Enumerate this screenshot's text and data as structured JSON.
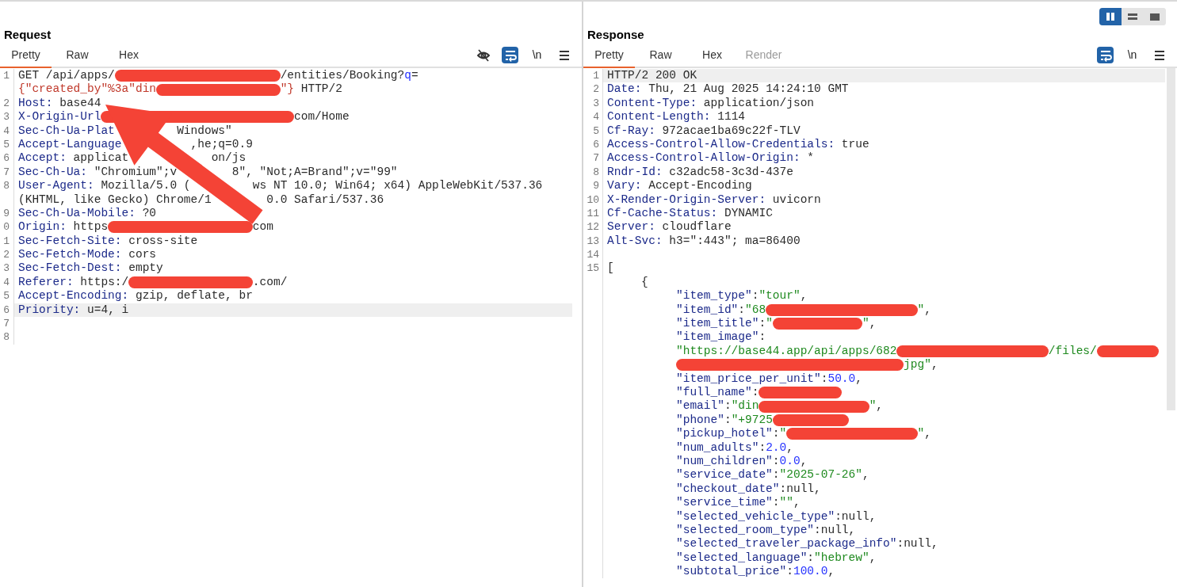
{
  "view_toggle": [
    {
      "kind": "columns",
      "selected": true
    },
    {
      "kind": "rows",
      "selected": false
    },
    {
      "kind": "single",
      "selected": false
    }
  ],
  "request": {
    "title": "Request",
    "tabs": [
      {
        "label": "Pretty",
        "selected": true,
        "disabled": false
      },
      {
        "label": "Raw",
        "selected": false,
        "disabled": false
      },
      {
        "label": "Hex",
        "selected": false,
        "disabled": false
      }
    ],
    "toolbar": [
      {
        "kind": "hide",
        "selected": false
      },
      {
        "kind": "wrap",
        "selected": true
      },
      {
        "kind": "newline",
        "label": "\\n",
        "selected": false
      },
      {
        "kind": "menu",
        "selected": false
      }
    ],
    "rows": [
      {
        "num": "1",
        "kind": "line",
        "selected": false,
        "tokens": [
          {
            "kind": "text",
            "text": "GET /api/apps/"
          },
          {
            "kind": "redacted"
          },
          {
            "kind": "text",
            "text": "/entities/Booking?"
          },
          {
            "kind": "param",
            "text": "q"
          },
          {
            "kind": "text",
            "text": "="
          }
        ]
      },
      {
        "kind": "line",
        "selected": false,
        "tokens": [
          {
            "kind": "query",
            "text": "{\"created_by\"%3a\"din"
          },
          {
            "kind": "redacted"
          },
          {
            "kind": "query",
            "text": "\"}"
          },
          {
            "kind": "text",
            "text": " HTTP/2"
          }
        ]
      },
      {
        "num": "2",
        "kind": "line",
        "selected": false,
        "tokens": [
          {
            "kind": "key",
            "text": "Host:"
          },
          {
            "kind": "text",
            "text": " base44"
          }
        ]
      },
      {
        "num": "3",
        "kind": "line",
        "selected": false,
        "tokens": [
          {
            "kind": "key",
            "text": "X-Origin-Url"
          },
          {
            "kind": "redacted"
          },
          {
            "kind": "text",
            "text": "com/Home"
          }
        ]
      },
      {
        "num": "4",
        "kind": "line",
        "selected": false,
        "tokens": [
          {
            "kind": "key",
            "text": "Sec-Ch-Ua-Plat"
          },
          {
            "kind": "covered"
          },
          {
            "kind": "text",
            "text": "Windows\""
          }
        ]
      },
      {
        "num": "5",
        "kind": "line",
        "selected": false,
        "tokens": [
          {
            "kind": "key",
            "text": "Accept-Language"
          },
          {
            "kind": "covered"
          },
          {
            "kind": "text",
            "text": ",he;q=0.9"
          }
        ]
      },
      {
        "num": "6",
        "kind": "line",
        "selected": false,
        "tokens": [
          {
            "kind": "key",
            "text": "Accept:"
          },
          {
            "kind": "text",
            "text": " applicat"
          },
          {
            "kind": "covered"
          },
          {
            "kind": "text",
            "text": "on/js"
          }
        ]
      },
      {
        "num": "7",
        "kind": "line",
        "selected": false,
        "tokens": [
          {
            "kind": "key",
            "text": "Sec-Ch-Ua:"
          },
          {
            "kind": "text",
            "text": " \"Chromium\";v"
          },
          {
            "kind": "covered"
          },
          {
            "kind": "text",
            "text": "8\", \"Not;A=Brand\";v=\"99\""
          }
        ]
      },
      {
        "num": "8",
        "kind": "line",
        "selected": false,
        "tokens": [
          {
            "kind": "key",
            "text": "User-Agent:"
          },
          {
            "kind": "text",
            "text": " Mozilla/5.0 ("
          },
          {
            "kind": "covered"
          },
          {
            "kind": "text",
            "text": "ws NT 10.0; Win64; x64) AppleWebKit/537.36"
          }
        ]
      },
      {
        "kind": "line",
        "selected": false,
        "tokens": [
          {
            "kind": "text",
            "text": "(KHTML, like Gecko) Chrome/1"
          },
          {
            "kind": "covered"
          },
          {
            "kind": "text",
            "text": "0.0 Safari/537.36"
          }
        ]
      },
      {
        "num": "9",
        "kind": "line",
        "selected": false,
        "tokens": [
          {
            "kind": "key",
            "text": "Sec-Ch-Ua-Mobile:"
          },
          {
            "kind": "text",
            "text": " ?0"
          }
        ]
      },
      {
        "num": "0",
        "kind": "line",
        "selected": false,
        "tokens": [
          {
            "kind": "key",
            "text": "Origin:"
          },
          {
            "kind": "text",
            "text": " https"
          },
          {
            "kind": "redacted"
          },
          {
            "kind": "text",
            "text": "com"
          }
        ]
      },
      {
        "num": "1",
        "kind": "line",
        "selected": false,
        "tokens": [
          {
            "kind": "key",
            "text": "Sec-Fetch-Site:"
          },
          {
            "kind": "text",
            "text": " cross-site"
          }
        ]
      },
      {
        "num": "2",
        "kind": "line",
        "selected": false,
        "tokens": [
          {
            "kind": "key",
            "text": "Sec-Fetch-Mode:"
          },
          {
            "kind": "text",
            "text": " cors"
          }
        ]
      },
      {
        "num": "3",
        "kind": "line",
        "selected": false,
        "tokens": [
          {
            "kind": "key",
            "text": "Sec-Fetch-Dest:"
          },
          {
            "kind": "text",
            "text": " empty"
          }
        ]
      },
      {
        "num": "4",
        "kind": "line",
        "selected": false,
        "tokens": [
          {
            "kind": "key",
            "text": "Referer:"
          },
          {
            "kind": "text",
            "text": " https:/"
          },
          {
            "kind": "redacted"
          },
          {
            "kind": "text",
            "text": ".com/"
          }
        ]
      },
      {
        "num": "5",
        "kind": "line",
        "selected": false,
        "tokens": [
          {
            "kind": "key",
            "text": "Accept-Encoding:"
          },
          {
            "kind": "text",
            "text": " gzip, deflate, br"
          }
        ]
      },
      {
        "num": "6",
        "kind": "line",
        "selected": true,
        "tokens": [
          {
            "kind": "key",
            "text": "Priority:"
          },
          {
            "kind": "text",
            "text": " u=4, i"
          }
        ]
      },
      {
        "num": "7",
        "kind": "line",
        "selected": false
      },
      {
        "num": "8",
        "kind": "line",
        "selected": false
      }
    ]
  },
  "response": {
    "title": "Response",
    "tabs": [
      {
        "label": "Pretty",
        "selected": true,
        "disabled": false
      },
      {
        "label": "Raw",
        "selected": false,
        "disabled": false
      },
      {
        "label": "Hex",
        "selected": false,
        "disabled": false
      },
      {
        "label": "Render",
        "selected": false,
        "disabled": true
      }
    ],
    "toolbar": [
      {
        "kind": "wrap",
        "selected": true
      },
      {
        "kind": "newline",
        "label": "\\n",
        "selected": false
      },
      {
        "kind": "menu",
        "selected": false
      }
    ],
    "rows": [
      {
        "num": "1",
        "kind": "line",
        "selected": true,
        "tokens": [
          {
            "kind": "text",
            "text": "HTTP/2 200 OK"
          }
        ]
      },
      {
        "num": "2",
        "kind": "line",
        "selected": false,
        "tokens": [
          {
            "kind": "key",
            "text": "Date:"
          },
          {
            "kind": "text",
            "text": " Thu, 21 Aug 2025 14:24:10 GMT"
          }
        ]
      },
      {
        "num": "3",
        "kind": "line",
        "selected": false,
        "tokens": [
          {
            "kind": "key",
            "text": "Content-Type:"
          },
          {
            "kind": "text",
            "text": " application/json"
          }
        ]
      },
      {
        "num": "4",
        "kind": "line",
        "selected": false,
        "tokens": [
          {
            "kind": "key",
            "text": "Content-Length:"
          },
          {
            "kind": "text",
            "text": " 1114"
          }
        ]
      },
      {
        "num": "5",
        "kind": "line",
        "selected": false,
        "tokens": [
          {
            "kind": "key",
            "text": "Cf-Ray:"
          },
          {
            "kind": "text",
            "text": " 972acae1ba69c22f-TLV"
          }
        ]
      },
      {
        "num": "6",
        "kind": "line",
        "selected": false,
        "tokens": [
          {
            "kind": "key",
            "text": "Access-Control-Allow-Credentials:"
          },
          {
            "kind": "text",
            "text": " true"
          }
        ]
      },
      {
        "num": "7",
        "kind": "line",
        "selected": false,
        "tokens": [
          {
            "kind": "key",
            "text": "Access-Control-Allow-Origin:"
          },
          {
            "kind": "text",
            "text": " *"
          }
        ]
      },
      {
        "num": "8",
        "kind": "line",
        "selected": false,
        "tokens": [
          {
            "kind": "key",
            "text": "Rndr-Id:"
          },
          {
            "kind": "text",
            "text": " c32adc58-3c3d-437e"
          }
        ]
      },
      {
        "num": "9",
        "kind": "line",
        "selected": false,
        "tokens": [
          {
            "kind": "key",
            "text": "Vary:"
          },
          {
            "kind": "text",
            "text": " Accept-Encoding"
          }
        ]
      },
      {
        "num": "10",
        "kind": "line",
        "selected": false,
        "tokens": [
          {
            "kind": "key",
            "text": "X-Render-Origin-Server:"
          },
          {
            "kind": "text",
            "text": " uvicorn"
          }
        ]
      },
      {
        "num": "11",
        "kind": "line",
        "selected": false,
        "tokens": [
          {
            "kind": "key",
            "text": "Cf-Cache-Status:"
          },
          {
            "kind": "text",
            "text": " DYNAMIC"
          }
        ]
      },
      {
        "num": "12",
        "kind": "line",
        "selected": false,
        "tokens": [
          {
            "kind": "key",
            "text": "Server:"
          },
          {
            "kind": "text",
            "text": " cloudflare"
          }
        ]
      },
      {
        "num": "13",
        "kind": "line",
        "selected": false,
        "tokens": [
          {
            "kind": "key",
            "text": "Alt-Svc:"
          },
          {
            "kind": "text",
            "text": " h3=\":443\"; ma=86400"
          }
        ]
      },
      {
        "num": "14",
        "kind": "line",
        "selected": false
      },
      {
        "num": "15",
        "kind": "line",
        "selected": false,
        "tokens": [
          {
            "kind": "text",
            "text": "["
          }
        ]
      },
      {
        "kind": "object",
        "selected": false,
        "tokens": [
          {
            "kind": "text",
            "text": "{"
          }
        ]
      },
      {
        "kind": "field",
        "selected": false,
        "tokens": [
          {
            "kind": "jkey",
            "text": "\"item_type\""
          },
          {
            "kind": "text",
            "text": ":"
          },
          {
            "kind": "string",
            "text": "\"tour\""
          },
          {
            "kind": "text",
            "text": ","
          }
        ]
      },
      {
        "kind": "field",
        "selected": false,
        "tokens": [
          {
            "kind": "jkey",
            "text": "\"item_id\""
          },
          {
            "kind": "text",
            "text": ":"
          },
          {
            "kind": "string",
            "text": "\"68"
          },
          {
            "kind": "redacted"
          },
          {
            "kind": "string",
            "text": "\""
          },
          {
            "kind": "text",
            "text": ","
          }
        ]
      },
      {
        "kind": "field",
        "selected": false,
        "tokens": [
          {
            "kind": "jkey",
            "text": "\"item_title\""
          },
          {
            "kind": "text",
            "text": ":"
          },
          {
            "kind": "string",
            "text": "\""
          },
          {
            "kind": "redacted"
          },
          {
            "kind": "string",
            "text": "\""
          },
          {
            "kind": "text",
            "text": ","
          }
        ]
      },
      {
        "kind": "field",
        "selected": false,
        "tokens": [
          {
            "kind": "jkey",
            "text": "\"item_image\""
          },
          {
            "kind": "text",
            "text": ":"
          }
        ]
      },
      {
        "kind": "field",
        "selected": false,
        "tokens": [
          {
            "kind": "string",
            "text": "\"https://base44.app/api/apps/682"
          },
          {
            "kind": "redacted"
          },
          {
            "kind": "string",
            "text": "/files/"
          },
          {
            "kind": "redacted"
          }
        ]
      },
      {
        "kind": "field",
        "selected": false,
        "tokens": [
          {
            "kind": "redacted"
          },
          {
            "kind": "string",
            "text": "jpg\""
          },
          {
            "kind": "text",
            "text": ","
          }
        ]
      },
      {
        "kind": "field",
        "selected": false,
        "tokens": [
          {
            "kind": "jkey",
            "text": "\"item_price_per_unit\""
          },
          {
            "kind": "text",
            "text": ":"
          },
          {
            "kind": "number",
            "text": "50.0"
          },
          {
            "kind": "text",
            "text": ","
          }
        ]
      },
      {
        "kind": "field",
        "selected": false,
        "tokens": [
          {
            "kind": "jkey",
            "text": "\"full_name\""
          },
          {
            "kind": "text",
            "text": ":"
          },
          {
            "kind": "redacted"
          }
        ]
      },
      {
        "kind": "field",
        "selected": false,
        "tokens": [
          {
            "kind": "jkey",
            "text": "\"email\""
          },
          {
            "kind": "text",
            "text": ":"
          },
          {
            "kind": "string",
            "text": "\"din"
          },
          {
            "kind": "redacted"
          },
          {
            "kind": "string",
            "text": "\""
          },
          {
            "kind": "text",
            "text": ","
          }
        ]
      },
      {
        "kind": "field",
        "selected": false,
        "tokens": [
          {
            "kind": "jkey",
            "text": "\"phone\""
          },
          {
            "kind": "text",
            "text": ":"
          },
          {
            "kind": "string",
            "text": "\"+9725"
          },
          {
            "kind": "redacted"
          }
        ]
      },
      {
        "kind": "field",
        "selected": false,
        "tokens": [
          {
            "kind": "jkey",
            "text": "\"pickup_hotel\""
          },
          {
            "kind": "text",
            "text": ":"
          },
          {
            "kind": "string",
            "text": "\""
          },
          {
            "kind": "redacted"
          },
          {
            "kind": "string",
            "text": "\""
          },
          {
            "kind": "text",
            "text": ","
          }
        ]
      },
      {
        "kind": "field",
        "selected": false,
        "tokens": [
          {
            "kind": "jkey",
            "text": "\"num_adults\""
          },
          {
            "kind": "text",
            "text": ":"
          },
          {
            "kind": "number",
            "text": "2.0"
          },
          {
            "kind": "text",
            "text": ","
          }
        ]
      },
      {
        "kind": "field",
        "selected": false,
        "tokens": [
          {
            "kind": "jkey",
            "text": "\"num_children\""
          },
          {
            "kind": "text",
            "text": ":"
          },
          {
            "kind": "number",
            "text": "0.0"
          },
          {
            "kind": "text",
            "text": ","
          }
        ]
      },
      {
        "kind": "field",
        "selected": false,
        "tokens": [
          {
            "kind": "jkey",
            "text": "\"service_date\""
          },
          {
            "kind": "text",
            "text": ":"
          },
          {
            "kind": "string",
            "text": "\"2025-07-26\""
          },
          {
            "kind": "text",
            "text": ","
          }
        ]
      },
      {
        "kind": "field",
        "selected": false,
        "tokens": [
          {
            "kind": "jkey",
            "text": "\"checkout_date\""
          },
          {
            "kind": "text",
            "text": ":null,"
          }
        ]
      },
      {
        "kind": "field",
        "selected": false,
        "tokens": [
          {
            "kind": "jkey",
            "text": "\"service_time\""
          },
          {
            "kind": "text",
            "text": ":"
          },
          {
            "kind": "string",
            "text": "\"\""
          },
          {
            "kind": "text",
            "text": ","
          }
        ]
      },
      {
        "kind": "field",
        "selected": false,
        "tokens": [
          {
            "kind": "jkey",
            "text": "\"selected_vehicle_type\""
          },
          {
            "kind": "text",
            "text": ":null,"
          }
        ]
      },
      {
        "kind": "field",
        "selected": false,
        "tokens": [
          {
            "kind": "jkey",
            "text": "\"selected_room_type\""
          },
          {
            "kind": "text",
            "text": ":null,"
          }
        ]
      },
      {
        "kind": "field",
        "selected": false,
        "tokens": [
          {
            "kind": "jkey",
            "text": "\"selected_traveler_package_info\""
          },
          {
            "kind": "text",
            "text": ":null,"
          }
        ]
      },
      {
        "kind": "field",
        "selected": false,
        "tokens": [
          {
            "kind": "jkey",
            "text": "\"selected_language\""
          },
          {
            "kind": "text",
            "text": ":"
          },
          {
            "kind": "string",
            "text": "\"hebrew\""
          },
          {
            "kind": "text",
            "text": ","
          }
        ]
      },
      {
        "kind": "field",
        "selected": false,
        "tokens": [
          {
            "kind": "jkey",
            "text": "\"subtotal_price\""
          },
          {
            "kind": "text",
            "text": ":"
          },
          {
            "kind": "number",
            "text": "100.0"
          },
          {
            "kind": "text",
            "text": ","
          }
        ]
      }
    ]
  }
}
